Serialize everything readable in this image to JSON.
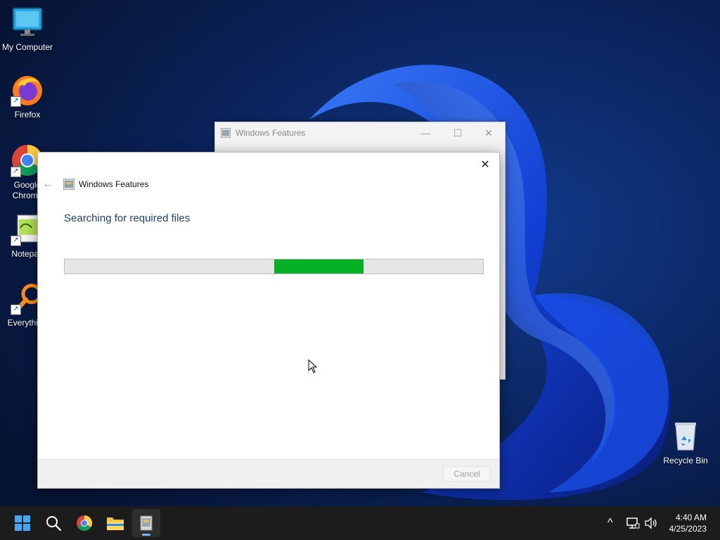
{
  "desktop": {
    "icons": [
      {
        "label": "My Computer",
        "icon": "monitor-icon"
      },
      {
        "label": "Firefox",
        "icon": "firefox-icon"
      },
      {
        "label": "Google Chrome",
        "icon": "chrome-icon"
      },
      {
        "label": "Notepad",
        "icon": "notepad-icon"
      },
      {
        "label": "Everything",
        "icon": "everything-icon"
      },
      {
        "label": "Recycle Bin",
        "icon": "recycle-bin-icon"
      }
    ]
  },
  "background_window": {
    "title": "Windows Features",
    "minimize": "—",
    "maximize": "☐",
    "close": "✕"
  },
  "dialog": {
    "title": "Windows Features",
    "back": "←",
    "close": "✕",
    "heading": "Searching for required files",
    "progress_marquee": true,
    "cancel_label": "Cancel",
    "cancel_enabled": false
  },
  "taskbar": {
    "pinned": [
      "start-icon",
      "search-icon",
      "chrome-icon",
      "file-explorer-icon",
      "windows-features-icon"
    ],
    "tray": {
      "chevron": "^",
      "time": "4:40 AM",
      "date": "4/25/2023"
    }
  },
  "colors": {
    "progress_fill": "#06b025",
    "heading": "#1e3f7a",
    "taskbar": "#1c1c1c"
  }
}
